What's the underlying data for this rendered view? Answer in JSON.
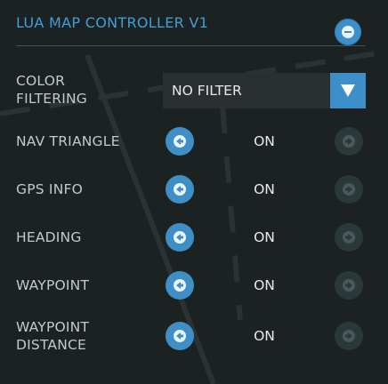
{
  "header": {
    "title": "LUA MAP CONTROLLER V1"
  },
  "color_filtering": {
    "label_line1": "COLOR",
    "label_line2": "FILTERING",
    "selected": "NO FILTER"
  },
  "rows": [
    {
      "label_line1": "NAV TRIANGLE",
      "label_line2": "",
      "value": "ON"
    },
    {
      "label_line1": "GPS INFO",
      "label_line2": "",
      "value": "ON"
    },
    {
      "label_line1": "HEADING",
      "label_line2": "",
      "value": "ON"
    },
    {
      "label_line1": "WAYPOINT",
      "label_line2": "",
      "value": "ON"
    },
    {
      "label_line1": "WAYPOINT",
      "label_line2": "DISTANCE",
      "value": "ON"
    }
  ],
  "colors": {
    "accent": "#3c8fc8",
    "title": "#3fa0d6",
    "background": "#1c2122",
    "disabled_arrow": "#2b3839"
  }
}
